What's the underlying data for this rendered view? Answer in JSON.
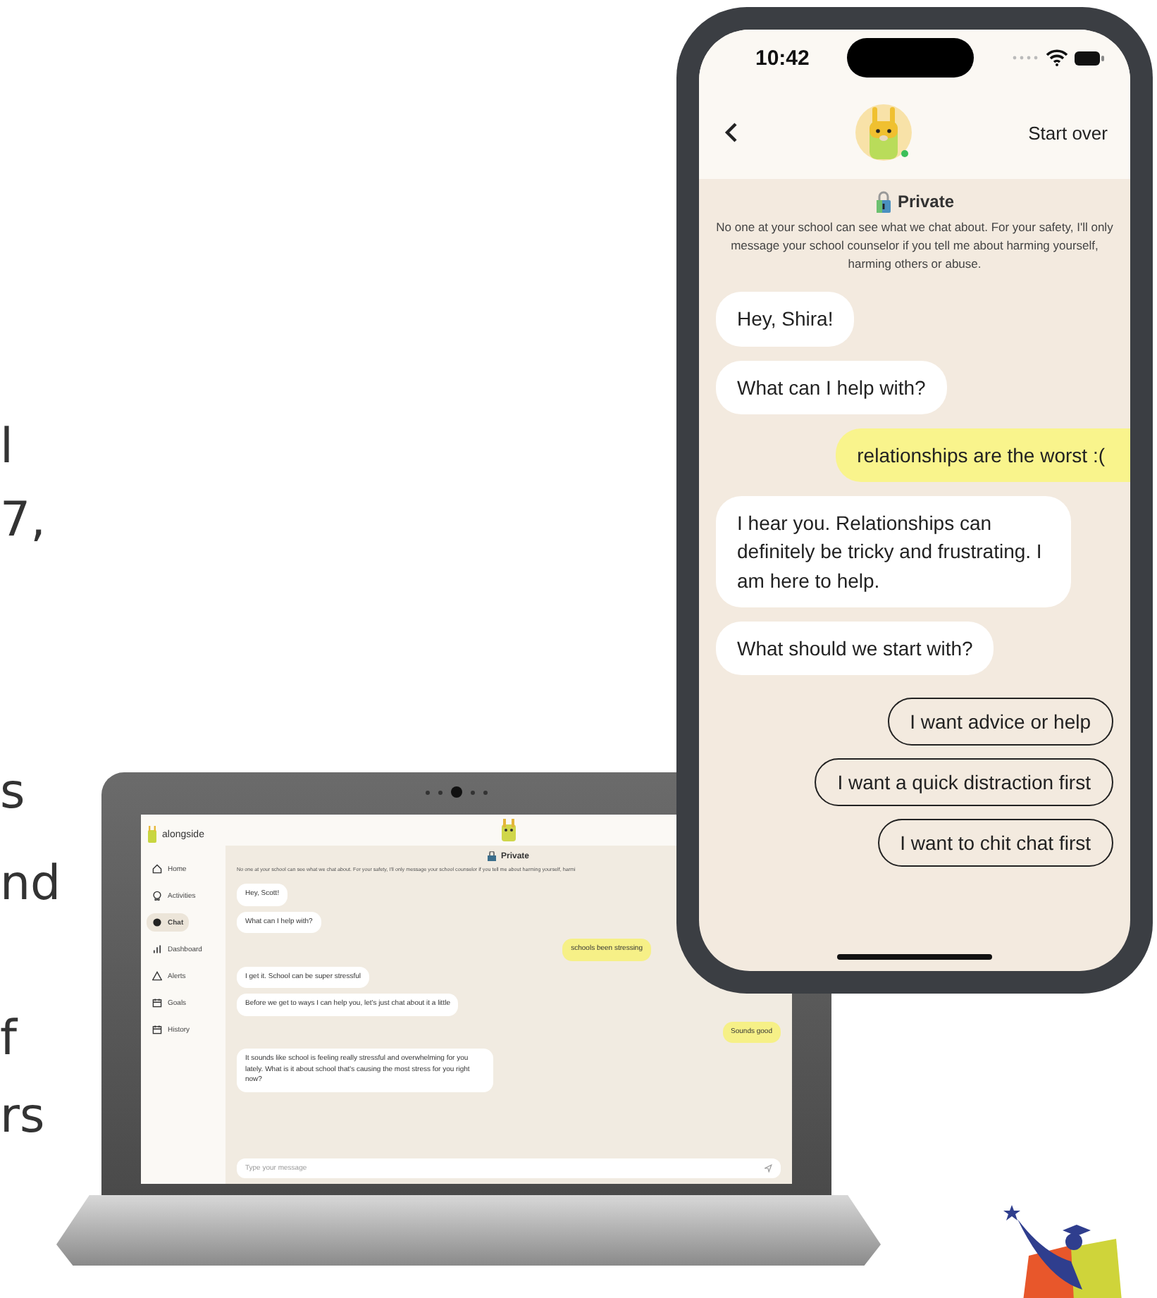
{
  "slide_text_fragments": [
    "l",
    "7,",
    "s",
    "nd",
    "f",
    "rs"
  ],
  "laptop": {
    "app_name": "alongside",
    "sidebar": {
      "items": [
        {
          "label": "Home",
          "selected": false
        },
        {
          "label": "Activities",
          "selected": false
        },
        {
          "label": "Chat",
          "selected": true
        },
        {
          "label": "Dashboard",
          "selected": false
        },
        {
          "label": "Alerts",
          "selected": false
        },
        {
          "label": "Goals",
          "selected": false
        },
        {
          "label": "History",
          "selected": false
        }
      ]
    },
    "privacy": {
      "title": "Private",
      "note": "No one at your school can see what we chat about. For your safety, I'll only message your school counselor if you tell me about harming yourself, harmi"
    },
    "messages": [
      {
        "kind": "bot",
        "text": "Hey, Scott!"
      },
      {
        "kind": "bot",
        "text": "What can I help with?"
      },
      {
        "kind": "user",
        "text": "schools been stressing"
      },
      {
        "kind": "bot",
        "text": "I get it. School can be super stressful"
      },
      {
        "kind": "bot",
        "text": "Before we get to ways I can help you, let's just chat about it a little"
      },
      {
        "kind": "user",
        "text": "Sounds good"
      },
      {
        "kind": "bot",
        "text": "It sounds like school is feeling really stressful and overwhelming for you lately. What is it about school that's causing the most stress for you right now?"
      }
    ],
    "input": {
      "placeholder": "Type your message"
    }
  },
  "phone": {
    "status_bar": {
      "time": "10:42"
    },
    "header": {
      "action": "Start over"
    },
    "privacy": {
      "title": "Private",
      "note": "No one at your school can see what we chat about. For your safety, I'll only message your school counselor if you tell me about harming yourself, harming others or abuse."
    },
    "messages": [
      {
        "kind": "bot",
        "text": "Hey, Shira!"
      },
      {
        "kind": "bot",
        "text": "What can I help with?"
      },
      {
        "kind": "user",
        "text": "relationships are the worst :("
      },
      {
        "kind": "bot",
        "text": "I hear you. Relationships can definitely be tricky and frustrating. I am here to help."
      },
      {
        "kind": "bot",
        "text": "What should we start with?"
      }
    ],
    "options": [
      "I want advice or help",
      "I want a quick distraction first",
      "I want to chit chat first"
    ]
  }
}
